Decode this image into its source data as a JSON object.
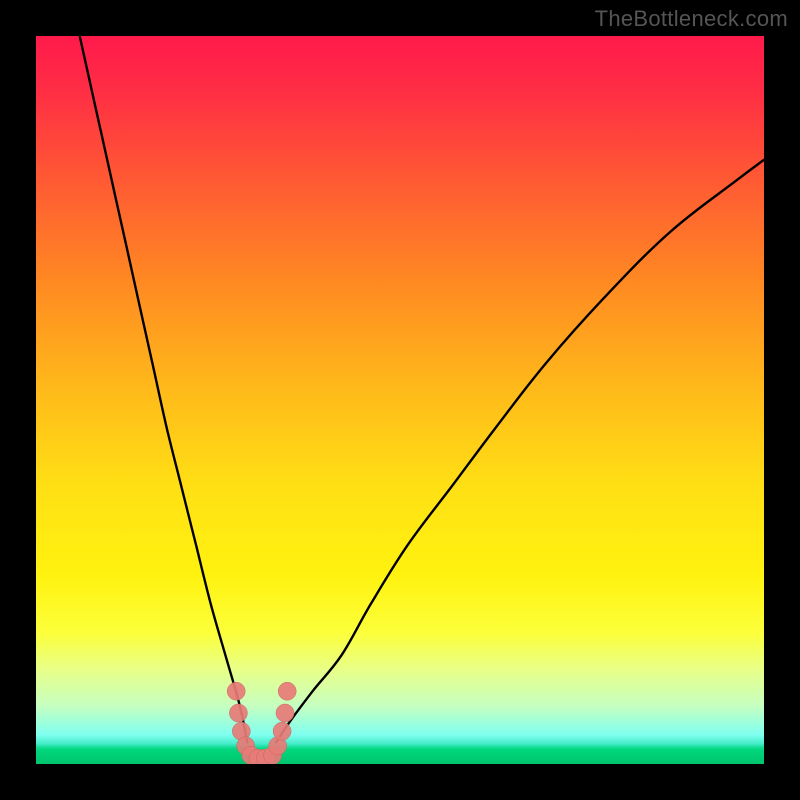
{
  "watermark": "TheBottleneck.com",
  "colors": {
    "frame_bg": "#000000",
    "watermark_text": "#555555",
    "curve_stroke": "#000000",
    "marker_fill": "#e77b77",
    "gradient_top": "#ff1a4b",
    "gradient_bottom": "#00d67c"
  },
  "chart_data": {
    "type": "line",
    "title": "",
    "xlabel": "",
    "ylabel": "",
    "xlim": [
      0,
      100
    ],
    "ylim": [
      0,
      100
    ],
    "grid": false,
    "legend": false,
    "notes": "Bottleneck-style V curve. No axis ticks or labels are visible; x and y values are normalized 0–100 estimates read off the plot pixels. Left branch (steep) and right branch (flatter) meet near x≈30 at y≈0.",
    "series": [
      {
        "name": "left_branch",
        "x": [
          6,
          8,
          10,
          12,
          14,
          16,
          18,
          20,
          22,
          24,
          26,
          28,
          29
        ],
        "y": [
          100,
          91,
          82,
          73,
          64,
          55,
          46,
          38,
          30,
          22,
          15,
          8,
          3
        ]
      },
      {
        "name": "right_branch",
        "x": [
          33,
          35,
          38,
          42,
          46,
          51,
          57,
          63,
          70,
          78,
          87,
          96,
          100
        ],
        "y": [
          3,
          6,
          10,
          15,
          22,
          30,
          38,
          46,
          55,
          64,
          73,
          80,
          83
        ]
      }
    ],
    "markers": {
      "name": "bottom_cluster",
      "points": [
        {
          "x": 27.5,
          "y": 10
        },
        {
          "x": 27.8,
          "y": 7
        },
        {
          "x": 28.2,
          "y": 4.5
        },
        {
          "x": 28.8,
          "y": 2.5
        },
        {
          "x": 29.5,
          "y": 1.2
        },
        {
          "x": 30.5,
          "y": 0.8
        },
        {
          "x": 31.5,
          "y": 0.8
        },
        {
          "x": 32.5,
          "y": 1.2
        },
        {
          "x": 33.2,
          "y": 2.5
        },
        {
          "x": 33.8,
          "y": 4.5
        },
        {
          "x": 34.2,
          "y": 7
        },
        {
          "x": 34.5,
          "y": 10
        }
      ]
    }
  }
}
